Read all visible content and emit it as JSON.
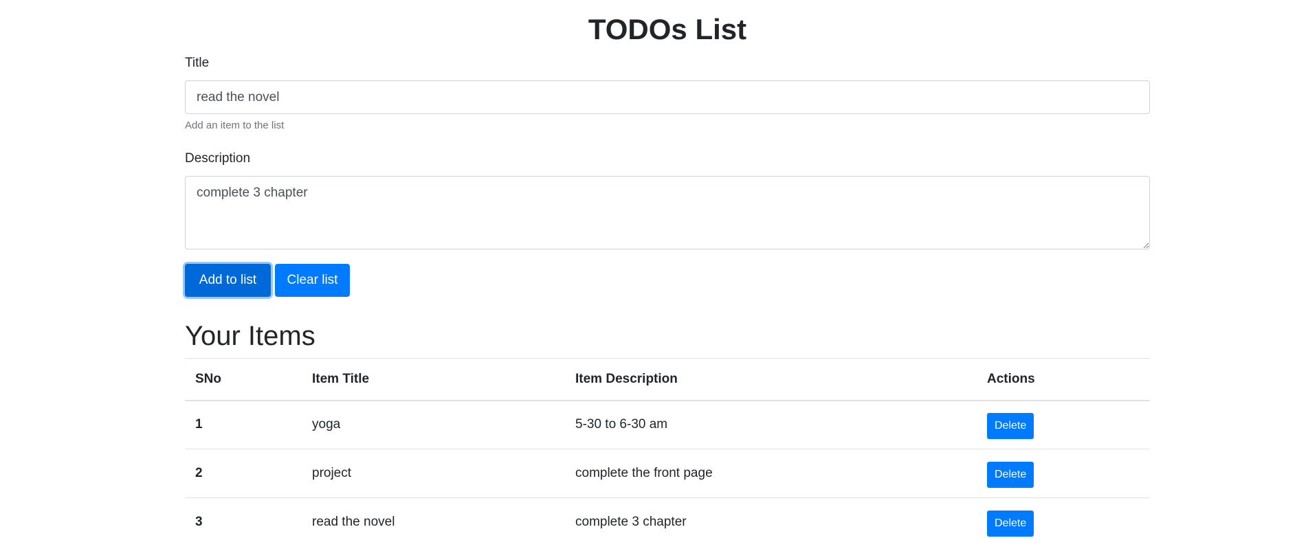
{
  "header": {
    "title": "TODOs List"
  },
  "form": {
    "title_label": "Title",
    "title_value": "read the novel",
    "title_help": "Add an item to the list",
    "description_label": "Description",
    "description_value": "complete 3 chapter",
    "add_button_label": "Add to list",
    "clear_button_label": "Clear list"
  },
  "items_section": {
    "heading": "Your Items",
    "columns": [
      "SNo",
      "Item Title",
      "Item Description",
      "Actions"
    ],
    "rows": [
      {
        "sno": "1",
        "title": "yoga",
        "description": "5-30 to 6-30 am",
        "action": "Delete"
      },
      {
        "sno": "2",
        "title": "project",
        "description": "complete the front page",
        "action": "Delete"
      },
      {
        "sno": "3",
        "title": "read the novel",
        "description": "complete 3 chapter",
        "action": "Delete"
      }
    ]
  },
  "colors": {
    "primary": "#007bff",
    "primary_active": "#0069d9",
    "text": "#212529",
    "muted": "#6c757d",
    "border": "#dee2e6"
  }
}
